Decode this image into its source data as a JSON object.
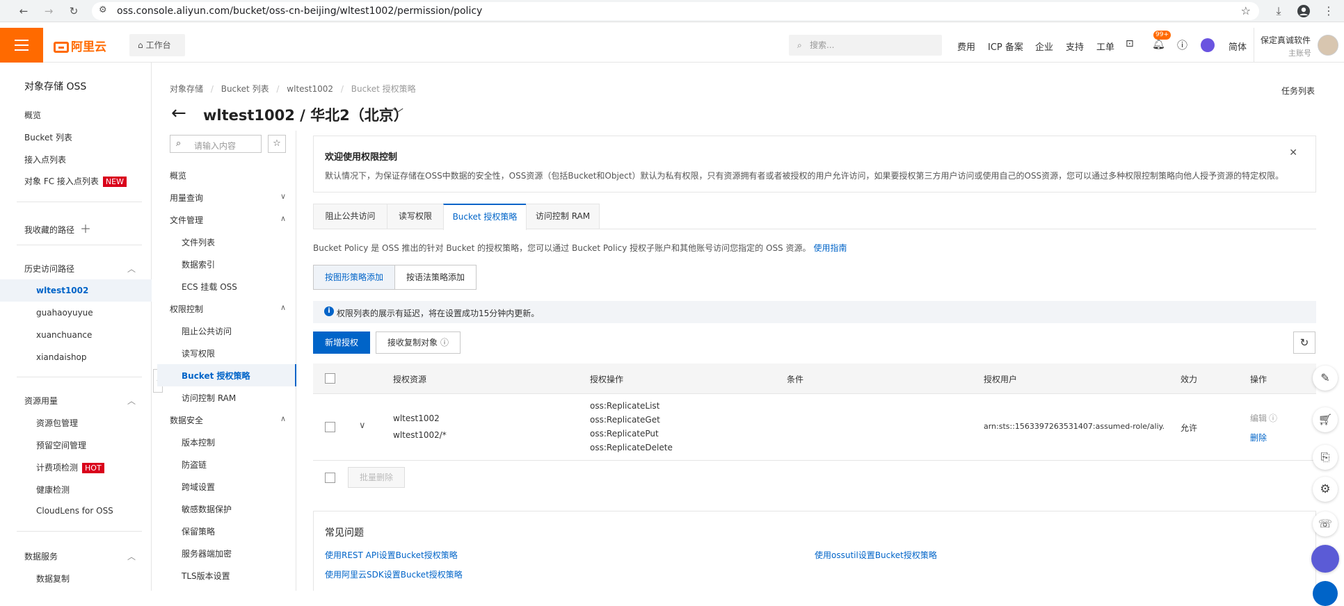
{
  "browser": {
    "url": "oss.console.aliyun.com/bucket/oss-cn-beijing/wltest1002/permission/policy"
  },
  "topnav": {
    "logo_text": "阿里云",
    "workbench": "工作台",
    "search_placeholder": "搜索...",
    "items": [
      "费用",
      "ICP 备案",
      "企业",
      "支持",
      "工单"
    ],
    "notif_count": "99+",
    "lang": "简体",
    "user_name": "保定真诚软件",
    "user_role": "主账号"
  },
  "sidebar": {
    "title": "对象存储 OSS",
    "items": [
      "概览",
      "Bucket 列表",
      "接入点列表",
      "对象 FC 接入点列表"
    ],
    "new_badge": "NEW",
    "favorites": "我收藏的路径",
    "history_title": "历史访问路径",
    "history": [
      "wltest1002",
      "guahaoyuyue",
      "xuanchuance",
      "xiandaishop"
    ],
    "resource_title": "资源用量",
    "resource_items": [
      "资源包管理",
      "预留空间管理",
      "计费项检测",
      "健康检测",
      "CloudLens for OSS"
    ],
    "hot_badge": "HOT",
    "data_service_title": "数据服务",
    "data_service_items": [
      "数据复制"
    ]
  },
  "breadcrumb": [
    "对象存储",
    "Bucket 列表",
    "wltest1002",
    "Bucket 授权策略"
  ],
  "page_title": "wltest1002 / 华北2（北京）",
  "task_list": "任务列表",
  "subnav": {
    "search_placeholder": "请输入内容",
    "overview": "概览",
    "usage": "用量查询",
    "file_mgmt": "文件管理",
    "file_items": [
      "文件列表",
      "数据索引",
      "ECS 挂载 OSS"
    ],
    "perm": "权限控制",
    "perm_items": [
      "阻止公共访问",
      "读写权限",
      "Bucket 授权策略",
      "访问控制 RAM"
    ],
    "security": "数据安全",
    "security_items": [
      "版本控制",
      "防盗链",
      "跨域设置",
      "敏感数据保护",
      "保留策略",
      "服务器端加密",
      "TLS版本设置"
    ]
  },
  "welcome": {
    "title": "欢迎使用权限控制",
    "text": "默认情况下，为保证存储在OSS中数据的安全性，OSS资源（包括Bucket和Object）默认为私有权限，只有资源拥有者或者被授权的用户允许访问，如果要授权第三方用户访问或使用自己的OSS资源，您可以通过多种权限控制策略向他人授予资源的特定权限。"
  },
  "tabs": [
    "阻止公共访问",
    "读写权限",
    "Bucket 授权策略",
    "访问控制 RAM"
  ],
  "policy_desc": "Bucket Policy 是 OSS 推出的针对 Bucket 的授权策略，您可以通过 Bucket Policy 授权子账户和其他账号访问您指定的 OSS 资源。",
  "guide_link": "使用指南",
  "mode_buttons": [
    "按图形策略添加",
    "按语法策略添加"
  ],
  "notice": "权限列表的展示有延迟，将在设置成功15分钟内更新。",
  "add_button": "新增授权",
  "receive_button": "接收复制对象",
  "table": {
    "headers": [
      "授权资源",
      "授权操作",
      "条件",
      "授权用户",
      "效力",
      "操作"
    ],
    "row": {
      "resources": [
        "wltest1002",
        "wltest1002/*"
      ],
      "actions": [
        "oss:ReplicateList",
        "oss:ReplicateGet",
        "oss:ReplicatePut",
        "oss:ReplicateDelete"
      ],
      "user": "arn:sts::1563397263531407:assumed-role/aliy...",
      "effect": "允许",
      "edit": "编辑",
      "delete": "删除"
    },
    "batch_delete": "批量删除"
  },
  "faq": {
    "title": "常见问题",
    "links": [
      "使用REST API设置Bucket授权策略",
      "使用ossutil设置Bucket授权策略",
      "使用阿里云SDK设置Bucket授权策略"
    ]
  },
  "colors": {
    "brand": "#ff6a00",
    "primary": "#0064c8",
    "active_bg": "#eff3f8"
  }
}
